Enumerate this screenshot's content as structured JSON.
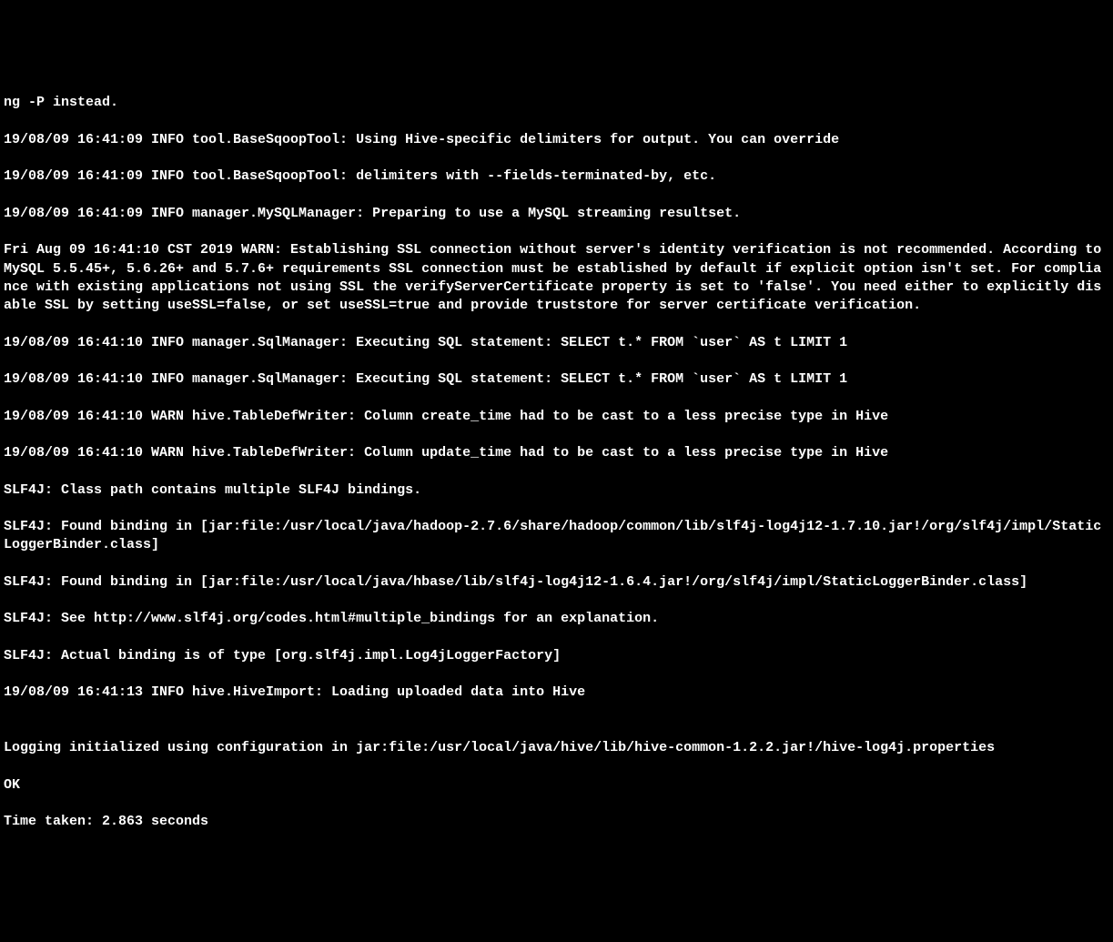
{
  "terminal": {
    "lines": [
      "ng -P instead.",
      "19/08/09 16:41:09 INFO tool.BaseSqoopTool: Using Hive-specific delimiters for output. You can override",
      "19/08/09 16:41:09 INFO tool.BaseSqoopTool: delimiters with --fields-terminated-by, etc.",
      "19/08/09 16:41:09 INFO manager.MySQLManager: Preparing to use a MySQL streaming resultset.",
      "Fri Aug 09 16:41:10 CST 2019 WARN: Establishing SSL connection without server's identity verification is not recommended. According to MySQL 5.5.45+, 5.6.26+ and 5.7.6+ requirements SSL connection must be established by default if explicit option isn't set. For compliance with existing applications not using SSL the verifyServerCertificate property is set to 'false'. You need either to explicitly disable SSL by setting useSSL=false, or set useSSL=true and provide truststore for server certificate verification.",
      "19/08/09 16:41:10 INFO manager.SqlManager: Executing SQL statement: SELECT t.* FROM `user` AS t LIMIT 1",
      "19/08/09 16:41:10 INFO manager.SqlManager: Executing SQL statement: SELECT t.* FROM `user` AS t LIMIT 1",
      "19/08/09 16:41:10 WARN hive.TableDefWriter: Column create_time had to be cast to a less precise type in Hive",
      "19/08/09 16:41:10 WARN hive.TableDefWriter: Column update_time had to be cast to a less precise type in Hive",
      "SLF4J: Class path contains multiple SLF4J bindings.",
      "SLF4J: Found binding in [jar:file:/usr/local/java/hadoop-2.7.6/share/hadoop/common/lib/slf4j-log4j12-1.7.10.jar!/org/slf4j/impl/StaticLoggerBinder.class]",
      "SLF4J: Found binding in [jar:file:/usr/local/java/hbase/lib/slf4j-log4j12-1.6.4.jar!/org/slf4j/impl/StaticLoggerBinder.class]",
      "SLF4J: See http://www.slf4j.org/codes.html#multiple_bindings for an explanation.",
      "SLF4J: Actual binding is of type [org.slf4j.impl.Log4jLoggerFactory]",
      "19/08/09 16:41:13 INFO hive.HiveImport: Loading uploaded data into Hive",
      "",
      "Logging initialized using configuration in jar:file:/usr/local/java/hive/lib/hive-common-1.2.2.jar!/hive-log4j.properties",
      "OK",
      "Time taken: 2.863 seconds"
    ]
  }
}
